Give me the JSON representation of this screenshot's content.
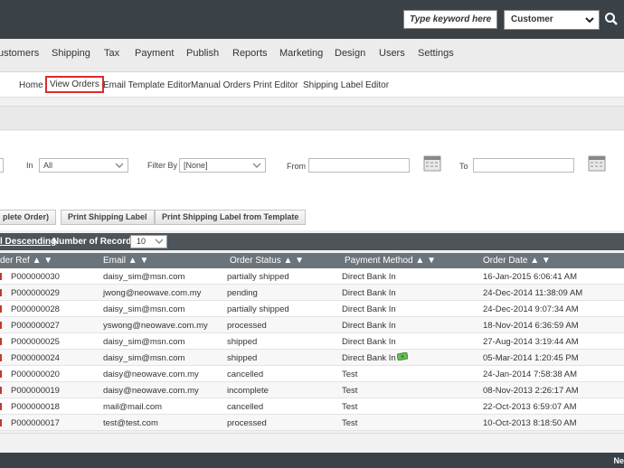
{
  "header": {
    "search_placeholder": "Type keyword here",
    "search_type": "Customer"
  },
  "main_nav": [
    "ustomers",
    "Shipping",
    "Tax",
    "Payment",
    "Publish",
    "Reports",
    "Marketing",
    "Design",
    "Users",
    "Settings"
  ],
  "sub_nav": [
    "Home",
    "View Orders",
    "Email Template Editor",
    "Manual Orders",
    "Print Editor",
    "Shipping Label Editor"
  ],
  "filters": {
    "in_label": "In",
    "in_value": "All",
    "filter_by_label": "Filter By",
    "filter_by_value": "[None]",
    "from_label": "From",
    "to_label": "To"
  },
  "buttons": [
    "plete Order)",
    "Print Shipping Label",
    "Print Shipping Label from Template"
  ],
  "list_bar": {
    "sort_link": "l Descending",
    "records_label": "Number of Records:",
    "records_value": "10"
  },
  "table": {
    "columns": [
      "der Ref",
      "Email",
      "Order Status",
      "Payment Method",
      "Order Date"
    ],
    "rows": [
      {
        "ref": "P000000030",
        "email": "daisy_sim@msn.com",
        "status": "partially shipped",
        "payment": "Direct Bank In",
        "date": "16-Jan-2015 6:06:41 AM"
      },
      {
        "ref": "P000000029",
        "email": "jwong@neowave.com.my",
        "status": "pending",
        "payment": "Direct Bank In",
        "date": "24-Dec-2014 11:38:09 AM"
      },
      {
        "ref": "P000000028",
        "email": "daisy_sim@msn.com",
        "status": "partially shipped",
        "payment": "Direct Bank In",
        "date": "24-Dec-2014 9:07:34 AM"
      },
      {
        "ref": "P000000027",
        "email": "yswong@neowave.com.my",
        "status": "processed",
        "payment": "Direct Bank In",
        "date": "18-Nov-2014 6:36:59 AM"
      },
      {
        "ref": "P000000025",
        "email": "daisy_sim@msn.com",
        "status": "shipped",
        "payment": "Direct Bank In",
        "date": "27-Aug-2014 3:19:44 AM"
      },
      {
        "ref": "P000000024",
        "email": "daisy_sim@msn.com",
        "status": "shipped",
        "payment": "Direct Bank In",
        "date": "05-Mar-2014 1:20:45 PM"
      },
      {
        "ref": "P000000020",
        "email": "daisy@neowave.com.my",
        "status": "cancelled",
        "payment": "Test",
        "date": "24-Jan-2014 7:58:38 AM"
      },
      {
        "ref": "P000000019",
        "email": "daisy@neowave.com.my",
        "status": "incomplete",
        "payment": "Test",
        "date": "08-Nov-2013 2:26:17 AM"
      },
      {
        "ref": "P000000018",
        "email": "mail@mail.com",
        "status": "cancelled",
        "payment": "Test",
        "date": "22-Oct-2013 6:59:07 AM"
      },
      {
        "ref": "P000000017",
        "email": "test@test.com",
        "status": "processed",
        "payment": "Test",
        "date": "10-Oct-2013 8:18:50 AM"
      }
    ]
  },
  "bottom_bar_text": "Ne",
  "colors": {
    "topbar": "#3a4147",
    "active_outline": "#e02a2a",
    "table_header": "#6c747b"
  }
}
